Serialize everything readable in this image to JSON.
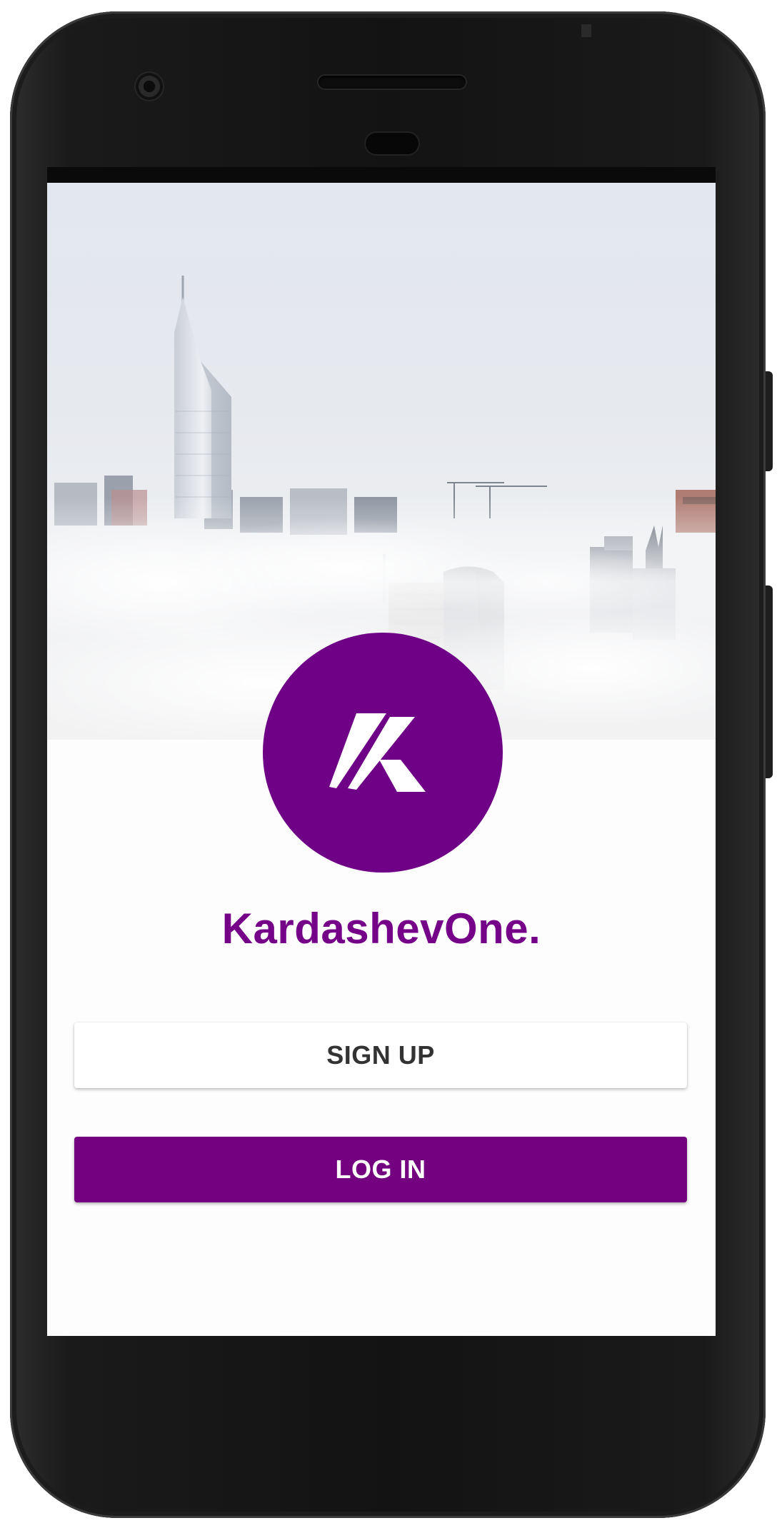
{
  "app": {
    "name": "KardashevOne.",
    "logo_letter": "K"
  },
  "hero": {
    "image": "city-skyline-in-fog"
  },
  "actions": {
    "signup_label": "SIGN UP",
    "login_label": "LOG IN"
  },
  "colors": {
    "brand_purple": "#74017f",
    "logo_circle": "#6e0185",
    "signup_text": "#333333",
    "background": "#fdfdfd"
  }
}
